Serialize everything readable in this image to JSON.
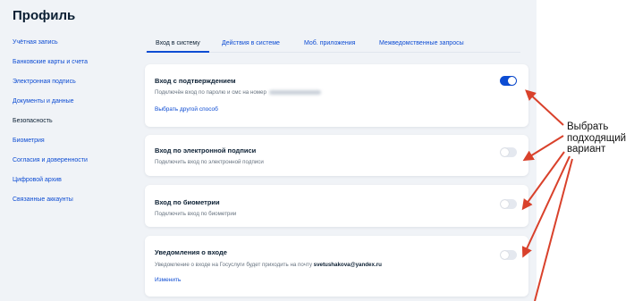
{
  "page": {
    "title": "Профиль"
  },
  "sidebar": {
    "items": [
      {
        "label": "Учётная запись",
        "active": false
      },
      {
        "label": "Банковские карты и счета",
        "active": false
      },
      {
        "label": "Электронная подпись",
        "active": false
      },
      {
        "label": "Документы и данные",
        "active": false
      },
      {
        "label": "Безопасность",
        "active": true
      },
      {
        "label": "Биометрия",
        "active": false
      },
      {
        "label": "Согласия и доверенности",
        "active": false
      },
      {
        "label": "Цифровой архив",
        "active": false
      },
      {
        "label": "Связанные аккаунты",
        "active": false
      }
    ]
  },
  "tabs": [
    {
      "label": "Вход в систему",
      "active": true
    },
    {
      "label": "Действия в системе",
      "active": false
    },
    {
      "label": "Моб. приложения",
      "active": false
    },
    {
      "label": "Межведомственные запросы",
      "active": false
    }
  ],
  "cards": {
    "confirmed_login": {
      "title": "Вход с подтверждением",
      "desc": "Подключён вход по паролю и смс на номер",
      "link": "Выбрать другой способ",
      "toggle_on": true
    },
    "esign_login": {
      "title": "Вход по электронной подписи",
      "desc": "Подключить вход по электронной подписи",
      "toggle_on": false
    },
    "biometric_login": {
      "title": "Вход по биометрии",
      "desc": "Подключить вход по биометрии",
      "toggle_on": false
    },
    "login_notifications": {
      "title": "Уведомления о входе",
      "desc": "Уведомление о входе на Госуслуги будет приходить на почту",
      "email": "svetushakova@yandex.ru",
      "link": "Изменить",
      "toggle_on": false
    }
  },
  "annotation": {
    "line1": "Выбрать",
    "line2": "подходящий",
    "line3": "вариант",
    "color": "#d9412b"
  },
  "colors": {
    "accent": "#0d4cd3",
    "text": "#0b1f33",
    "muted": "#66727f",
    "background": "#f0f3f7"
  }
}
